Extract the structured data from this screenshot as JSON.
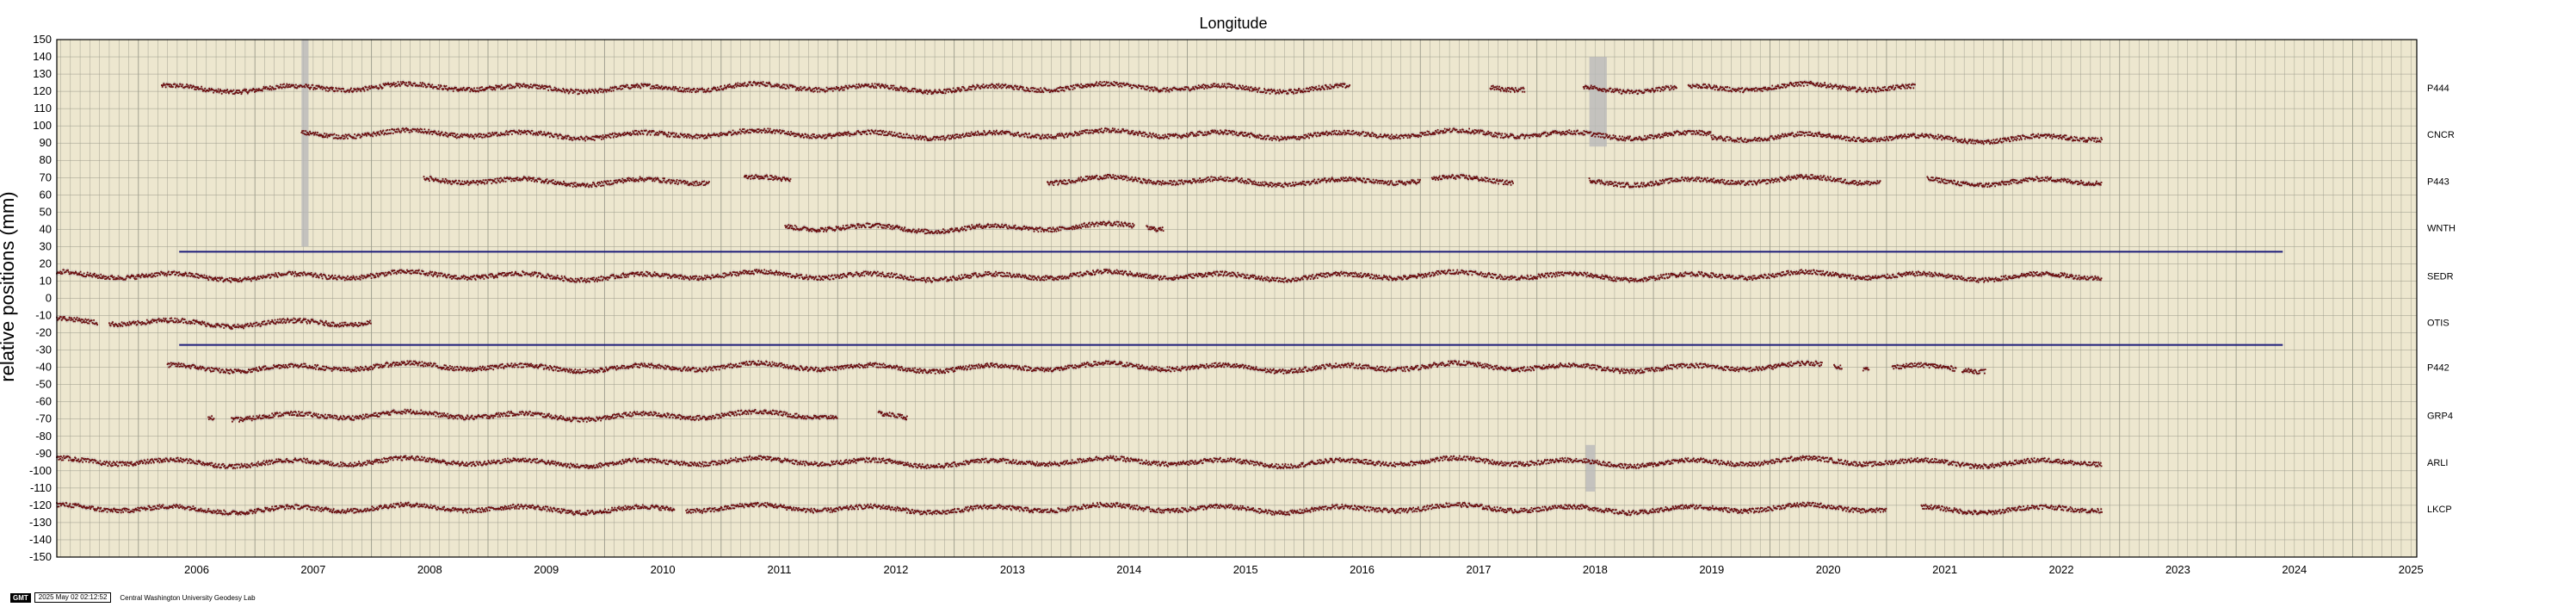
{
  "chart_data": {
    "type": "scatter",
    "title": "Longitude",
    "ylabel": "relative positions (mm)",
    "xlabel": "",
    "xlim": [
      2005.3,
      2025.55
    ],
    "ylim": [
      -150,
      150
    ],
    "grid": true,
    "ytick_step": 10,
    "xticks": [
      "2006",
      "2007",
      "2008",
      "2009",
      "2010",
      "2011",
      "2012",
      "2013",
      "2014",
      "2015",
      "2016",
      "2017",
      "2018",
      "2019",
      "2020",
      "2021",
      "2022",
      "2023",
      "2024",
      "2025"
    ],
    "colors": {
      "background": "#ede7cf",
      "points": "#6b0f0f",
      "grid": "#9a9a8a",
      "spread": "#b9b9b9",
      "reference_line": "#1c1c7a"
    },
    "series": [
      {
        "name": "P444",
        "offset": 122,
        "segments": [
          [
            2006.2,
            2016.4,
            0
          ],
          [
            2017.6,
            2017.9,
            0
          ],
          [
            2018.4,
            2019.2,
            0
          ],
          [
            2019.3,
            2021.25,
            0
          ]
        ]
      },
      {
        "name": "CNCR",
        "offset": 95,
        "segments": [
          [
            2007.4,
            2019.5,
            0
          ],
          [
            2019.5,
            2022.85,
            -2
          ]
        ]
      },
      {
        "name": "P443",
        "offset": 68,
        "segments": [
          [
            2008.45,
            2010.9,
            0
          ],
          [
            2011.2,
            2011.6,
            0
          ],
          [
            2013.8,
            2017.0,
            0
          ],
          [
            2017.1,
            2017.8,
            0
          ],
          [
            2018.45,
            2020.95,
            0
          ],
          [
            2021.35,
            2022.85,
            0
          ]
        ]
      },
      {
        "name": "WNTH",
        "offset": 41,
        "segments": [
          [
            2011.55,
            2014.55,
            0
          ],
          [
            2014.65,
            2014.8,
            0
          ]
        ]
      },
      {
        "name": "SEDR",
        "offset": 13,
        "segments": [
          [
            2005.3,
            2022.85,
            0
          ]
        ]
      },
      {
        "name": "OTIS",
        "offset": -14,
        "segments": [
          [
            2005.3,
            2005.65,
            0
          ],
          [
            2005.75,
            2008.0,
            0
          ]
        ]
      },
      {
        "name": "P442",
        "offset": -40,
        "segments": [
          [
            2006.25,
            2020.45,
            0
          ],
          [
            2020.55,
            2020.62,
            0
          ],
          [
            2020.8,
            2020.85,
            0
          ],
          [
            2021.05,
            2021.6,
            0
          ],
          [
            2021.65,
            2021.85,
            0
          ]
        ]
      },
      {
        "name": "GRP4",
        "offset": -68,
        "segments": [
          [
            2006.6,
            2006.65,
            0
          ],
          [
            2006.8,
            2012.0,
            0
          ],
          [
            2012.35,
            2012.6,
            0
          ]
        ]
      },
      {
        "name": "ARLI",
        "offset": -95,
        "segments": [
          [
            2005.3,
            2022.85,
            0
          ]
        ]
      },
      {
        "name": "LKCP",
        "offset": -122,
        "segments": [
          [
            2005.3,
            2010.6,
            0
          ],
          [
            2010.7,
            2021.0,
            0
          ],
          [
            2021.3,
            2022.85,
            0
          ]
        ]
      }
    ],
    "reference_lines": [
      {
        "y": 27,
        "x": [
          2006.35,
          2024.4
        ]
      },
      {
        "y": -27,
        "x": [
          2006.35,
          2024.4
        ]
      }
    ],
    "spread_bands": [
      {
        "x": [
          2007.4,
          2007.46
        ],
        "y": [
          30,
          150
        ]
      },
      {
        "x": [
          2018.45,
          2018.6
        ],
        "y": [
          88,
          140
        ]
      },
      {
        "x": [
          2018.42,
          2018.5
        ],
        "y": [
          -112,
          -85
        ]
      }
    ]
  },
  "footer": {
    "gmt_badge": "GMT",
    "timestamp": "2025 May 02 02:12:52",
    "credit": "Central Washington University Geodesy Lab"
  }
}
